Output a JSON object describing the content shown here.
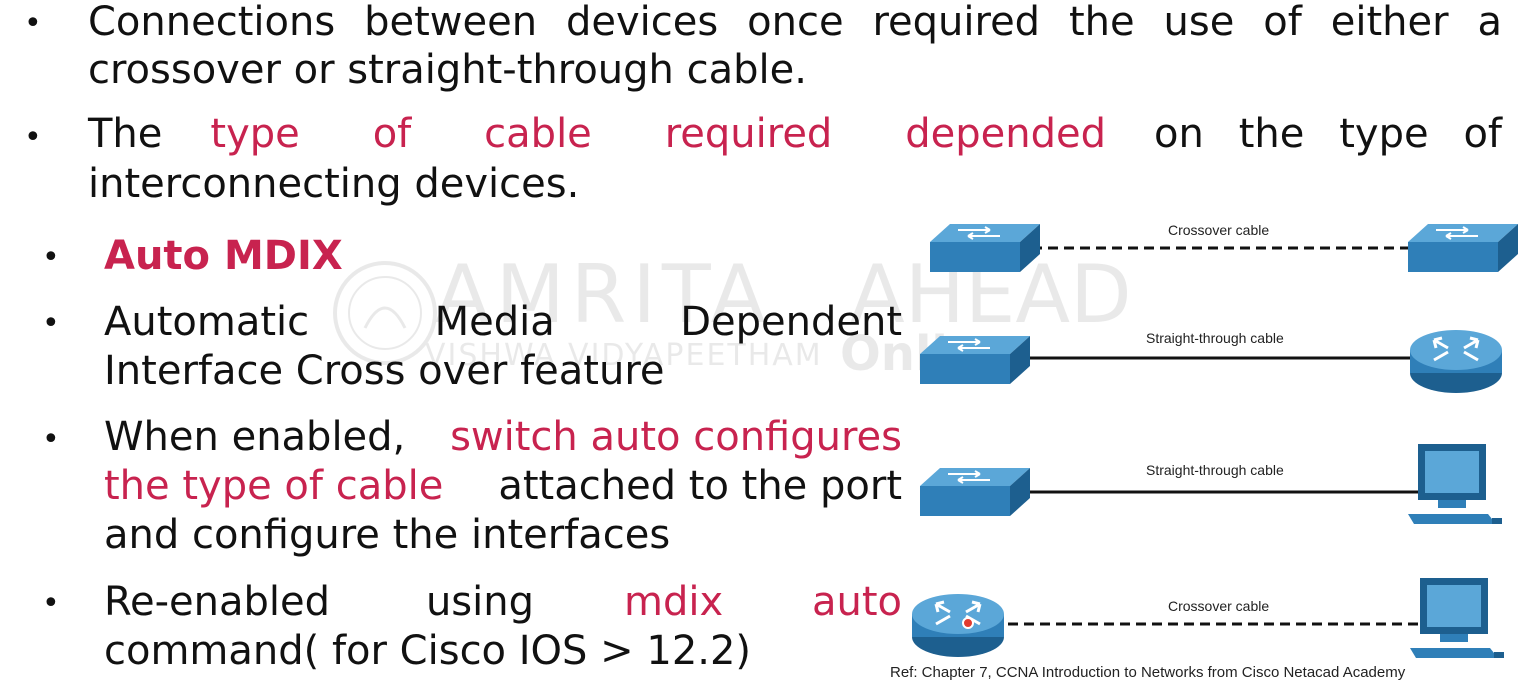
{
  "bullets": {
    "b1": {
      "line1": "Connections between devices once required the use of either a",
      "line2": "crossover or straight-through cable."
    },
    "b2": {
      "line1_a": "The",
      "line1_red": "type of cable required depended",
      "line1_b": "on the type of",
      "line2": "interconnecting devices."
    },
    "b3": {
      "text": "Auto MDIX"
    },
    "b4": {
      "line1": "Automatic Media Dependent",
      "line2": "Interface Cross over feature"
    },
    "b5": {
      "line1_a": "When enabled,",
      "line1_red": "switch auto configures",
      "line2_red": "the type of cable",
      "line2_b": "attached to the port",
      "line3": "and configure the interfaces"
    },
    "b6": {
      "line1_a": "Re-enabled using",
      "line1_red": "mdix auto",
      "line2": "command( for Cisco IOS > 12.2)"
    },
    "bullet_char": "•"
  },
  "watermark": {
    "brand": "AMRITA",
    "brand2": "AHEAD",
    "sub": "VISHWA VIDYAPEETHAM",
    "sub2": "Onli"
  },
  "diagram": {
    "rows": [
      {
        "label": "Crossover cable",
        "left_device": "switch",
        "right_device": "switch",
        "line": "dashed"
      },
      {
        "label": "Straight-through cable",
        "left_device": "switch",
        "right_device": "router",
        "line": "solid"
      },
      {
        "label": "Straight-through cable",
        "left_device": "switch",
        "right_device": "pc",
        "line": "solid"
      },
      {
        "label": "Crossover cable",
        "left_device": "router",
        "right_device": "pc",
        "line": "dashed"
      }
    ]
  },
  "reference": "Ref: Chapter 7, CCNA Introduction to Networks from Cisco Netacad Academy",
  "colors": {
    "accent": "#c8234f",
    "device_blue": "#2f7fb8",
    "device_dark": "#1d5f8f"
  }
}
